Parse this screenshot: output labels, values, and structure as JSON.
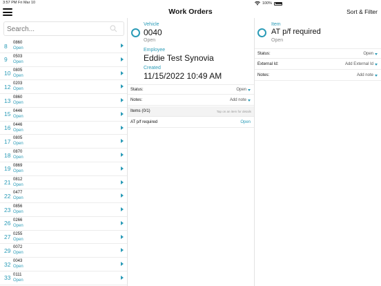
{
  "status_bar": {
    "time": "3:57 PM",
    "date": "Fri Mar 10",
    "battery": "100%"
  },
  "nav": {
    "title": "Work Orders",
    "sort_filter": "Sort & Filter"
  },
  "search": {
    "placeholder": "Search..."
  },
  "work_orders": [
    {
      "num": "8",
      "code": "0860",
      "status": "Open"
    },
    {
      "num": "9",
      "code": "0503",
      "status": "Open"
    },
    {
      "num": "10",
      "code": "0805",
      "status": "Open"
    },
    {
      "num": "12",
      "code": "0203",
      "status": "Open"
    },
    {
      "num": "13",
      "code": "0860",
      "status": "Open"
    },
    {
      "num": "15",
      "code": "0446",
      "status": "Open"
    },
    {
      "num": "16",
      "code": "0446",
      "status": "Open"
    },
    {
      "num": "17",
      "code": "0805",
      "status": "Open"
    },
    {
      "num": "18",
      "code": "0870",
      "status": "Open"
    },
    {
      "num": "19",
      "code": "0869",
      "status": "Open"
    },
    {
      "num": "21",
      "code": "0812",
      "status": "Open"
    },
    {
      "num": "22",
      "code": "0477",
      "status": "Open"
    },
    {
      "num": "23",
      "code": "0856",
      "status": "Open"
    },
    {
      "num": "26",
      "code": "0266",
      "status": "Open"
    },
    {
      "num": "27",
      "code": "0255",
      "status": "Open"
    },
    {
      "num": "29",
      "code": "0072",
      "status": "Open"
    },
    {
      "num": "32",
      "code": "0043",
      "status": "Open"
    },
    {
      "num": "33",
      "code": "0111",
      "status": "Open"
    }
  ],
  "detail": {
    "vehicle_label": "Vehicle",
    "vehicle_value": "0040",
    "vehicle_status": "Open",
    "employee_label": "Employee",
    "employee_value": "Eddie Test Synovia",
    "created_label": "Created",
    "created_value": "11/15/2022 10:49 AM",
    "status_label": "Status:",
    "status_value": "Open",
    "notes_label": "Notes:",
    "notes_value": "Add note",
    "items_header": "Items (0/1)",
    "items_hint": "Tap on an item for details",
    "items": [
      {
        "name": "AT p/f required",
        "status": "Open"
      }
    ]
  },
  "item_detail": {
    "item_label": "Item",
    "item_value": "AT p/f required",
    "item_status": "Open",
    "status_label": "Status:",
    "status_value": "Open",
    "external_label": "External Id:",
    "external_value": "Add External Id",
    "notes_label": "Notes:",
    "notes_value": "Add note"
  },
  "colors": {
    "accent": "#2a9bb7"
  }
}
